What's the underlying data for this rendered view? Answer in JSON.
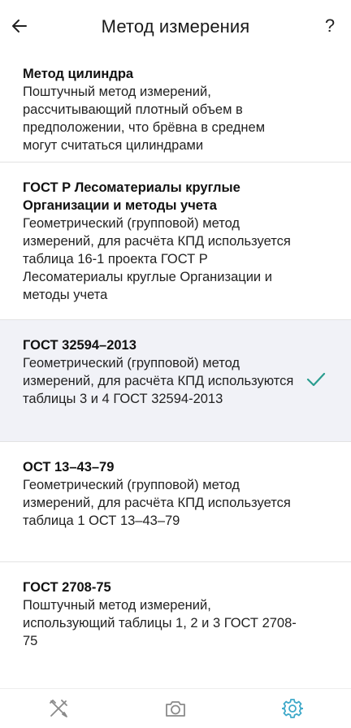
{
  "header": {
    "title": "Метод измерения",
    "back_icon": "arrow-left-icon",
    "help_label": "?"
  },
  "methods": [
    {
      "title": "Метод цилиндра",
      "desc": "Поштучный метод измерений, рассчитывающий плотный объем в предположении, что брёвна в среднем могут считаться цилиндрами",
      "selected": false
    },
    {
      "title": "ГОСТ Р Лесоматериалы круглые Организации и методы учета",
      "desc": "Геометрический (групповой) метод измерений, для расчёта КПД используется таблица 16-1 проекта ГОСТ Р Лесоматериалы круглые Организации и методы учета",
      "selected": false
    },
    {
      "title": "ГОСТ 32594–2013",
      "desc": "Геометрический (групповой) метод измерений, для расчёта КПД используются таблицы 3 и 4 ГОСТ 32594-2013",
      "selected": true
    },
    {
      "title": "ОСТ 13–43–79",
      "desc": "Геометрический (групповой) метод измерений, для расчёта КПД используется таблица 1 ОСТ 13–43–79",
      "selected": false
    },
    {
      "title": "ГОСТ 2708-75",
      "desc": "Поштучный метод измерений, использующий таблицы 1, 2 и 3 ГОСТ 2708-75",
      "selected": false
    }
  ],
  "bottom_nav": [
    {
      "icon": "tools-icon",
      "active": false
    },
    {
      "icon": "camera-icon",
      "active": false
    },
    {
      "icon": "gear-icon",
      "active": true
    }
  ],
  "colors": {
    "accent": "#2a9d8f",
    "selected_bg": "#f1f2f7",
    "nav_inactive": "#8a8a8a",
    "nav_active": "#3fa9c9"
  }
}
